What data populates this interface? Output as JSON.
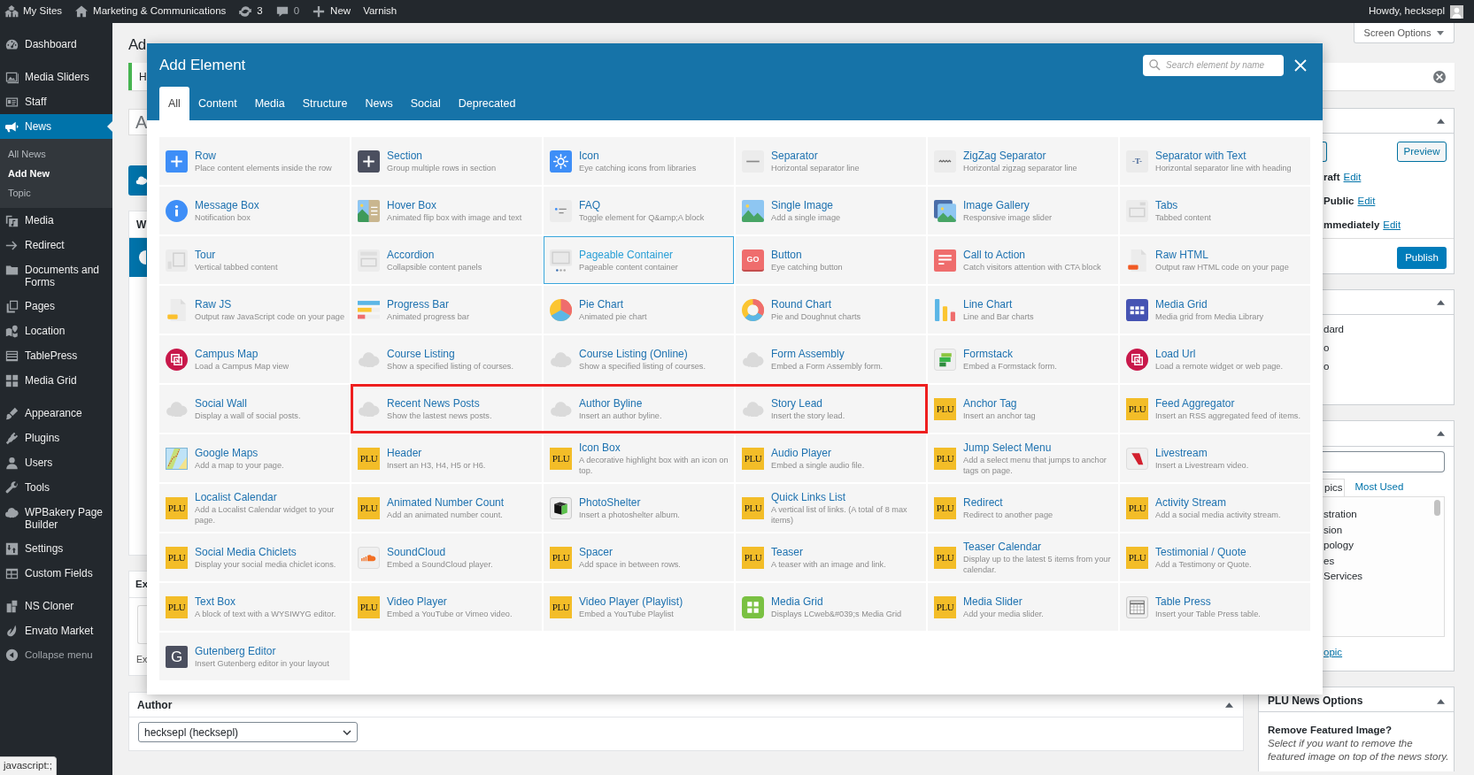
{
  "admin_bar": {
    "items": [
      {
        "kind": "sites",
        "label": "My Sites"
      },
      {
        "kind": "home",
        "label": "Marketing & Communications"
      },
      {
        "kind": "updates",
        "label": "3"
      },
      {
        "kind": "comments",
        "label": "0"
      },
      {
        "kind": "new",
        "label": "New"
      },
      {
        "kind": "plain",
        "label": "Varnish"
      }
    ],
    "account": "Howdy, hecksepl"
  },
  "sidebar": {
    "groups": [
      [
        {
          "label": "Dashboard",
          "kind": "dashboard",
          "selected": false
        }
      ],
      [
        {
          "label": "Media Sliders",
          "kind": "sliders",
          "selected": false
        },
        {
          "label": "Staff",
          "kind": "staff",
          "selected": false
        },
        {
          "label": "News",
          "kind": "news",
          "selected": true,
          "children": [
            {
              "label": "All News",
              "selected": false
            },
            {
              "label": "Add New",
              "selected": true
            },
            {
              "label": "Topic",
              "selected": false
            }
          ]
        },
        {
          "label": "Media",
          "kind": "media",
          "selected": false
        },
        {
          "label": "Redirect",
          "kind": "redirect",
          "selected": false
        },
        {
          "label": "Documents and Forms",
          "kind": "documents",
          "selected": false
        },
        {
          "label": "Pages",
          "kind": "pages",
          "selected": false
        },
        {
          "label": "Location",
          "kind": "location",
          "selected": false
        },
        {
          "label": "TablePress",
          "kind": "tablepress",
          "selected": false
        },
        {
          "label": "Media Grid",
          "kind": "mediagrid",
          "selected": false
        }
      ],
      [
        {
          "label": "Appearance",
          "kind": "appearance",
          "selected": false
        },
        {
          "label": "Plugins",
          "kind": "plugins",
          "selected": false
        },
        {
          "label": "Users",
          "kind": "users",
          "selected": false
        },
        {
          "label": "Tools",
          "kind": "tools",
          "selected": false
        },
        {
          "label": "WPBakery Page Builder",
          "kind": "wpbakery",
          "selected": false
        },
        {
          "label": "Settings",
          "kind": "settings",
          "selected": false
        },
        {
          "label": "Custom Fields",
          "kind": "customfields",
          "selected": false
        }
      ],
      [
        {
          "label": "NS Cloner",
          "kind": "nscloner",
          "selected": false
        },
        {
          "label": "Envato Market",
          "kind": "envato",
          "selected": false
        }
      ]
    ],
    "collapse": "Collapse menu"
  },
  "page": {
    "heading": "Ad",
    "screen_options": "Screen Options",
    "notice": "H",
    "title_field": "A",
    "editor_box": {
      "title": "W"
    },
    "excerpt_box": {
      "title": "Ex",
      "hint": "Ex"
    },
    "author_box": {
      "title": "Author",
      "value": "hecksepl (hecksepl)"
    }
  },
  "publish_box": {
    "preview": "Preview",
    "settings": [
      {
        "value": "raft",
        "link": "Edit"
      },
      {
        "value": "Public",
        "link": "Edit"
      },
      {
        "value": "mmediately",
        "link": "Edit"
      }
    ],
    "publish": "Publish"
  },
  "list_box": {
    "items": [
      "dard",
      "o",
      "o"
    ]
  },
  "topics_box": {
    "tabs": [
      {
        "label": "pics",
        "selected": true
      },
      {
        "label": "Most Used",
        "selected": false
      }
    ],
    "items": [
      "stration",
      "sion",
      "pology",
      "es",
      "Services"
    ],
    "link": "opic"
  },
  "news_options": {
    "title": "PLU News Options",
    "question": "Remove Featured Image?",
    "help": "Select if you want to remove the featured image on top of the news story."
  },
  "modal": {
    "title": "Add Element",
    "search": {
      "placeholder": "Search element by name"
    },
    "tabs": [
      {
        "label": "All",
        "selected": true
      },
      {
        "label": "Content",
        "selected": false
      },
      {
        "label": "Media",
        "selected": false
      },
      {
        "label": "Structure",
        "selected": false
      },
      {
        "label": "News",
        "selected": false
      },
      {
        "label": "Social",
        "selected": false
      },
      {
        "label": "Deprecated",
        "selected": false
      }
    ],
    "elements": [
      {
        "title": "Row",
        "description": "Place content elements inside the row",
        "kind": "row",
        "hovered": false,
        "marked": false
      },
      {
        "title": "Section",
        "description": "Group multiple rows in section",
        "kind": "section",
        "hovered": false,
        "marked": false
      },
      {
        "title": "Icon",
        "description": "Eye catching icons from libraries",
        "kind": "icon",
        "hovered": false,
        "marked": false
      },
      {
        "title": "Separator",
        "description": "Horizontal separator line",
        "kind": "separator",
        "hovered": false,
        "marked": false
      },
      {
        "title": "ZigZag Separator",
        "description": "Horizontal zigzag separator line",
        "kind": "zigzag",
        "hovered": false,
        "marked": false
      },
      {
        "title": "Separator with Text",
        "description": "Horizontal separator line with heading",
        "kind": "septext",
        "icon_label": "-T-",
        "hovered": false,
        "marked": false
      },
      {
        "title": "Message Box",
        "description": "Notification box",
        "kind": "message",
        "hovered": false,
        "marked": false
      },
      {
        "title": "Hover Box",
        "description": "Animated flip box with image and text",
        "kind": "hover",
        "hovered": false,
        "marked": false
      },
      {
        "title": "FAQ",
        "description": "Toggle element for Q&amp;A block",
        "kind": "faq",
        "hovered": false,
        "marked": false
      },
      {
        "title": "Single Image",
        "description": "Add a single image",
        "kind": "image",
        "hovered": false,
        "marked": false
      },
      {
        "title": "Image Gallery",
        "description": "Responsive image slider",
        "kind": "gallery",
        "hovered": false,
        "marked": false
      },
      {
        "title": "Tabs",
        "description": "Tabbed content",
        "kind": "tabs",
        "hovered": false,
        "marked": false
      },
      {
        "title": "Tour",
        "description": "Vertical tabbed content",
        "kind": "tour",
        "hovered": false,
        "marked": false
      },
      {
        "title": "Accordion",
        "description": "Collapsible content panels",
        "kind": "accordion",
        "hovered": false,
        "marked": false
      },
      {
        "title": "Pageable Container",
        "description": "Pageable content container",
        "kind": "pageable",
        "hovered": true,
        "marked": false
      },
      {
        "title": "Button",
        "description": "Eye catching button",
        "kind": "button",
        "icon_label": "GO",
        "hovered": false,
        "marked": false
      },
      {
        "title": "Call to Action",
        "description": "Catch visitors attention with CTA block",
        "kind": "cta",
        "hovered": false,
        "marked": false
      },
      {
        "title": "Raw HTML",
        "description": "Output raw HTML code on your page",
        "kind": "html",
        "hovered": false,
        "marked": false
      },
      {
        "title": "Raw JS",
        "description": "Output raw JavaScript code on your page",
        "kind": "js",
        "hovered": false,
        "marked": false
      },
      {
        "title": "Progress Bar",
        "description": "Animated progress bar",
        "kind": "progress",
        "hovered": false,
        "marked": false
      },
      {
        "title": "Pie Chart",
        "description": "Animated pie chart",
        "kind": "pie",
        "hovered": false,
        "marked": false
      },
      {
        "title": "Round Chart",
        "description": "Pie and Doughnut charts",
        "kind": "round",
        "hovered": false,
        "marked": false
      },
      {
        "title": "Line Chart",
        "description": "Line and Bar charts",
        "kind": "line",
        "hovered": false,
        "marked": false
      },
      {
        "title": "Media Grid",
        "description": "Media grid from Media Library",
        "kind": "mediagrid",
        "hovered": false,
        "marked": false
      },
      {
        "title": "Campus Map",
        "description": "Load a Campus Map view",
        "kind": "circle",
        "hovered": false,
        "marked": false
      },
      {
        "title": "Course Listing",
        "description": "Show a specified listing of courses.",
        "kind": "cloud",
        "hovered": false,
        "marked": false
      },
      {
        "title": "Course Listing (Online)",
        "description": "Show a specified listing of courses.",
        "kind": "cloud",
        "hovered": false,
        "marked": false
      },
      {
        "title": "Form Assembly",
        "description": "Embed a Form Assembly form.",
        "kind": "cloud",
        "hovered": false,
        "marked": false
      },
      {
        "title": "Formstack",
        "description": "Embed a Formstack form.",
        "kind": "formstack",
        "hovered": false,
        "marked": false
      },
      {
        "title": "Load Url",
        "description": "Load a remote widget or web page.",
        "kind": "circle",
        "hovered": false,
        "marked": false
      },
      {
        "title": "Social Wall",
        "description": "Display a wall of social posts.",
        "kind": "cloud",
        "hovered": false,
        "marked": false
      },
      {
        "title": "Recent News Posts",
        "description": "Show the lastest news posts.",
        "kind": "cloud",
        "hovered": false,
        "marked": true
      },
      {
        "title": "Author Byline",
        "description": "Insert an author byline.",
        "kind": "cloud",
        "hovered": false,
        "marked": true
      },
      {
        "title": "Story Lead",
        "description": "Insert the story lead.",
        "kind": "cloud",
        "hovered": false,
        "marked": true
      },
      {
        "title": "Anchor Tag",
        "description": "Insert an anchor tag",
        "kind": "plu",
        "icon_label": "PLU",
        "hovered": false,
        "marked": false
      },
      {
        "title": "Feed Aggregator",
        "description": "Insert an RSS aggregated feed of items.",
        "kind": "plu",
        "icon_label": "PLU",
        "hovered": false,
        "marked": false
      },
      {
        "title": "Google Maps",
        "description": "Add a map to your page.",
        "kind": "map",
        "hovered": false,
        "marked": false
      },
      {
        "title": "Header",
        "description": "Insert an H3, H4, H5 or H6.",
        "kind": "plu",
        "icon_label": "PLU",
        "hovered": false,
        "marked": false
      },
      {
        "title": "Icon Box",
        "description": "A decorative highlight box with an icon on top.",
        "kind": "plu",
        "icon_label": "PLU",
        "hovered": false,
        "marked": false
      },
      {
        "title": "Audio Player",
        "description": "Embed a single audio file.",
        "kind": "plu",
        "icon_label": "PLU",
        "hovered": false,
        "marked": false
      },
      {
        "title": "Jump Select Menu",
        "description": "Add a select menu that jumps to anchor tags on page.",
        "kind": "plu",
        "icon_label": "PLU",
        "hovered": false,
        "marked": false
      },
      {
        "title": "Livestream",
        "description": "Insert a Livestream video.",
        "kind": "livestream",
        "hovered": false,
        "marked": false
      },
      {
        "title": "Localist Calendar",
        "description": "Add a Localist Calendar widget to your page.",
        "kind": "plu",
        "icon_label": "PLU",
        "hovered": false,
        "marked": false
      },
      {
        "title": "Animated Number Count",
        "description": "Add an animated number count.",
        "kind": "plu",
        "icon_label": "PLU",
        "hovered": false,
        "marked": false
      },
      {
        "title": "PhotoShelter",
        "description": "Insert a photoshelter album.",
        "kind": "photo",
        "hovered": false,
        "marked": false
      },
      {
        "title": "Quick Links List",
        "description": "A vertical list of links. (A total of 8 max items)",
        "kind": "plu",
        "icon_label": "PLU",
        "hovered": false,
        "marked": false
      },
      {
        "title": "Redirect",
        "description": "Redirect to another page",
        "kind": "plu",
        "icon_label": "PLU",
        "hovered": false,
        "marked": false
      },
      {
        "title": "Activity Stream",
        "description": "Add a social media activity stream.",
        "kind": "plu",
        "icon_label": "PLU",
        "hovered": false,
        "marked": false
      },
      {
        "title": "Social Media Chiclets",
        "description": "Display your social media chiclet icons.",
        "kind": "plu",
        "icon_label": "PLU",
        "hovered": false,
        "marked": false
      },
      {
        "title": "SoundCloud",
        "description": "Embed a SoundCloud player.",
        "kind": "soundcloud",
        "hovered": false,
        "marked": false
      },
      {
        "title": "Spacer",
        "description": "Add space in between rows.",
        "kind": "plu",
        "icon_label": "PLU",
        "hovered": false,
        "marked": false
      },
      {
        "title": "Teaser",
        "description": "A teaser with an image and link.",
        "kind": "plu",
        "icon_label": "PLU",
        "hovered": false,
        "marked": false
      },
      {
        "title": "Teaser Calendar",
        "description": "Display up to the latest 5 items from your calendar.",
        "kind": "plu",
        "icon_label": "PLU",
        "hovered": false,
        "marked": false
      },
      {
        "title": "Testimonial / Quote",
        "description": "Add a Testimony or Quote.",
        "kind": "plu",
        "icon_label": "PLU",
        "hovered": false,
        "marked": false
      },
      {
        "title": "Text Box",
        "description": "A block of text with a WYSIWYG editor.",
        "kind": "plu",
        "icon_label": "PLU",
        "hovered": false,
        "marked": false
      },
      {
        "title": "Video Player",
        "description": "Embed a YouTube or Vimeo video.",
        "kind": "plu",
        "icon_label": "PLU",
        "hovered": false,
        "marked": false
      },
      {
        "title": "Video Player (Playlist)",
        "description": "Embed a YouTube Playlist",
        "kind": "plu",
        "icon_label": "PLU",
        "hovered": false,
        "marked": false
      },
      {
        "title": "Media Grid",
        "description": "Displays LCweb&#039;s Media Grid",
        "kind": "greengrid",
        "hovered": false,
        "marked": false
      },
      {
        "title": "Media Slider",
        "description": "Add your media slider.",
        "kind": "plu",
        "icon_label": "PLU",
        "hovered": false,
        "marked": false
      },
      {
        "title": "Table Press",
        "description": "Insert your Table Press table.",
        "kind": "tablepress",
        "hovered": false,
        "marked": false
      },
      {
        "title": "Gutenberg Editor",
        "description": "Insert Gutenberg editor in your layout",
        "kind": "gutenberg",
        "icon_label": "G",
        "hovered": false,
        "marked": false
      }
    ]
  },
  "status_text": "javascript:;"
}
